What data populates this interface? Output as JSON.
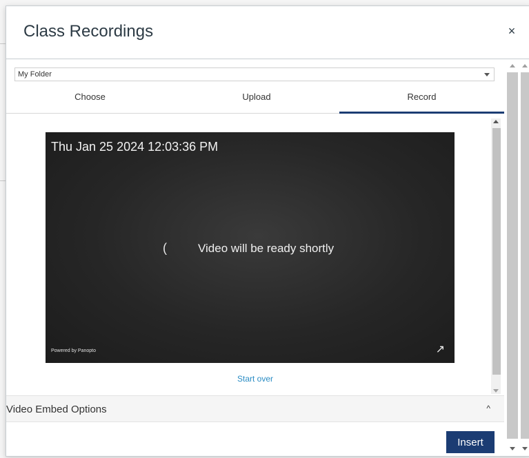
{
  "modal": {
    "title": "Class Recordings",
    "close_glyph": "×"
  },
  "folder": {
    "selected": "My Folder"
  },
  "tabs": [
    {
      "label": "Choose",
      "active": false
    },
    {
      "label": "Upload",
      "active": false
    },
    {
      "label": "Record",
      "active": true
    }
  ],
  "video": {
    "timestamp": "Thu Jan 25 2024 12:03:36 PM",
    "spinner_glyph": "(",
    "status_message": "Video will be ready shortly",
    "powered_by": "Powered by Panopto",
    "expand_glyph": "↗"
  },
  "start_over_label": "Start over",
  "embed_options": {
    "label": "Video Embed Options",
    "caret_glyph": "^"
  },
  "insert_label": "Insert",
  "colors": {
    "accent": "#1b3c73",
    "link": "#2a8cc4",
    "video_bg": "#262626"
  },
  "icons": [
    "close-icon",
    "dropdown-arrow-icon",
    "spinner-icon",
    "expand-icon",
    "caret-up-icon"
  ]
}
